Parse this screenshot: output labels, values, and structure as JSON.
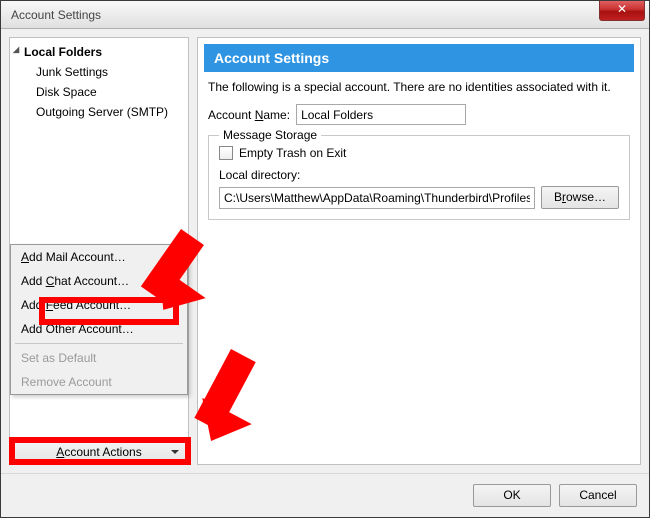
{
  "window": {
    "title": "Account Settings"
  },
  "sidebar": {
    "root": "Local Folders",
    "children": [
      "Junk Settings",
      "Disk Space",
      "Outgoing Server (SMTP)"
    ],
    "account_actions_label": "Account Actions"
  },
  "popup": {
    "add_mail": "Add Mail Account…",
    "add_chat": "Add Chat Account…",
    "add_feed": "Add Feed Account…",
    "add_other": "Add Other Account…",
    "set_default": "Set as Default",
    "remove": "Remove Account"
  },
  "main": {
    "header": "Account Settings",
    "description": "The following is a special account. There are no identities associated with it.",
    "account_name_label": "Account Name:",
    "account_name_value": "Local Folders",
    "storage_legend": "Message Storage",
    "empty_trash_label": "Empty Trash on Exit",
    "local_dir_label": "Local directory:",
    "local_dir_value": "C:\\Users\\Matthew\\AppData\\Roaming\\Thunderbird\\Profiles\\",
    "browse_label": "Browse…"
  },
  "footer": {
    "ok": "OK",
    "cancel": "Cancel"
  }
}
